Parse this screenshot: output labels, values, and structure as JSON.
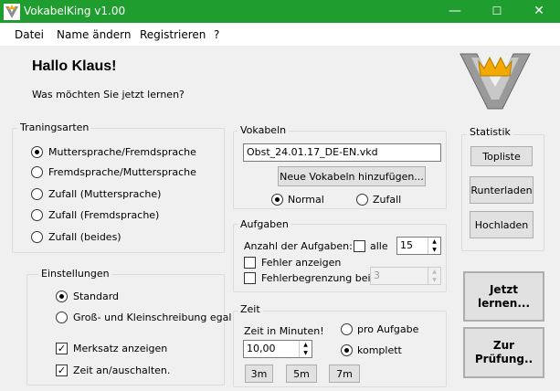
{
  "window": {
    "title": "VokabelKing v1.00",
    "minimize": "—",
    "maximize": "☐",
    "close": "✕"
  },
  "menu": [
    "Datei",
    "Name ändern",
    "Registrieren",
    "?"
  ],
  "greeting": "Hallo Klaus!",
  "prompt": "Was möchten Sie jetzt lernen?",
  "trainingsarten": {
    "title": "Traningsarten",
    "options": [
      "Muttersprache/Fremdsprache",
      "Fremdsprache/Muttersprache",
      "Zufall (Muttersprache)",
      "Zufall (Fremdsprache)",
      "Zufall (beides)"
    ],
    "selected": 0
  },
  "einstellungen": {
    "title": "Einstellungen",
    "radio": [
      "Standard",
      "Groß- und Kleinschreibung egal"
    ],
    "selected": 0,
    "checks": [
      {
        "label": "Merksatz anzeigen",
        "checked": true
      },
      {
        "label": "Zeit an/auschalten.",
        "checked": true
      }
    ]
  },
  "vokabeln": {
    "title": "Vokabeln",
    "file": "Obst_24.01.17_DE-EN.vkd",
    "add_button": "Neue Vokabeln hinzufügen...",
    "modes": [
      "Normal",
      "Zufall"
    ],
    "selected": 0
  },
  "aufgaben": {
    "title": "Aufgaben",
    "count_label": "Anzahl der Aufgaben:",
    "alle_label": "alle",
    "alle_checked": false,
    "count_value": "15",
    "fehler_anzeigen": "Fehler anzeigen",
    "fehlerbegrenzung": "Fehlerbegrenzung bei",
    "fehler_value": "3"
  },
  "zeit": {
    "title": "Zeit",
    "minutes_label": "Zeit in Minuten!",
    "minutes_value": "10,00",
    "modes": [
      "pro Aufgabe",
      "komplett"
    ],
    "selected": 1,
    "presets": [
      "3m",
      "5m",
      "7m"
    ]
  },
  "statistik": {
    "title": "Statistik",
    "buttons": [
      "Topliste",
      "Runterladen",
      "Hochladen"
    ]
  },
  "actions": {
    "learn": "Jetzt lernen...",
    "exam": "Zur Prüfung.."
  },
  "colors": {
    "titlebar": "#1f9d2e",
    "crown": "#f2a900",
    "logo_v": "#8c8c8c"
  }
}
